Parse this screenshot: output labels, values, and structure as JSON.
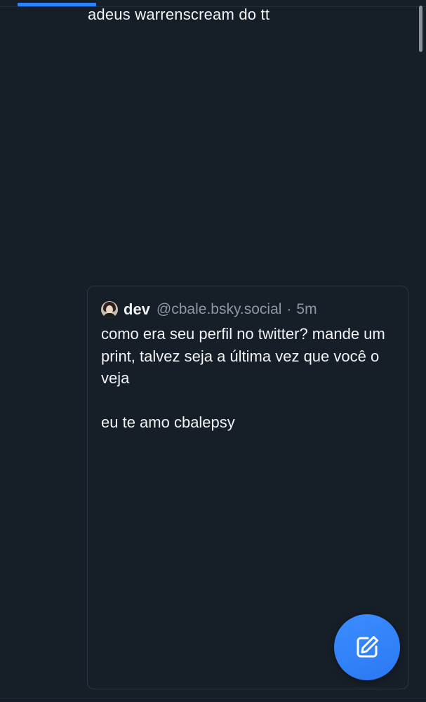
{
  "post": {
    "text": "adeus warrenscream do tt"
  },
  "quote": {
    "author_name": "dev",
    "author_handle": "@cbale.bsky.social",
    "separator": "·",
    "time": "5m",
    "paragraph_1": "como era seu perfil no twitter? mande um print, talvez seja a última vez que você o veja",
    "paragraph_2": "eu te amo cbalepsy"
  },
  "colors": {
    "background": "#161e27",
    "accent": "#2a84ff",
    "muted_text": "#8d98a5",
    "card_border": "#2c3642"
  },
  "icons": {
    "compose": "compose-icon",
    "avatar": "avatar"
  }
}
